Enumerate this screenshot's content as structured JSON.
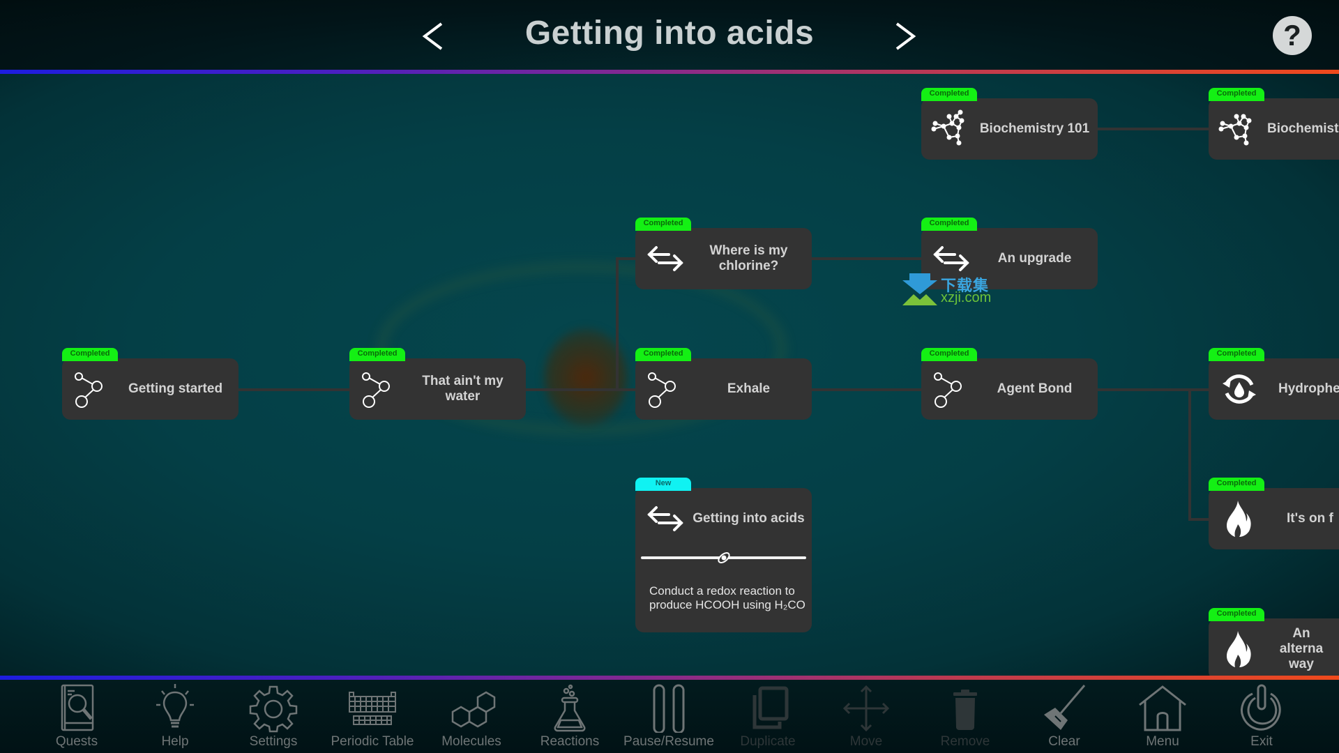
{
  "header": {
    "title": "Getting into acids",
    "prev_label": "<",
    "next_label": ">",
    "help_label": "?"
  },
  "nodes": [
    {
      "id": "biochemistry-101",
      "title": "Biochemistry 101",
      "status": "Completed",
      "icon": "molecule-structure-icon"
    },
    {
      "id": "biochemistry-2",
      "title": "Biochemist",
      "status": "Completed",
      "icon": "molecule-structure-icon"
    },
    {
      "id": "where-is-my-chlorine",
      "title": "Where is my chlorine?",
      "status": "Completed",
      "icon": "exchange-arrows-icon"
    },
    {
      "id": "an-upgrade",
      "title": "An upgrade",
      "status": "Completed",
      "icon": "exchange-arrows-icon"
    },
    {
      "id": "getting-started",
      "title": "Getting started",
      "status": "Completed",
      "icon": "bond-icon"
    },
    {
      "id": "that-aint-my-water",
      "title": "That ain't my water",
      "status": "Completed",
      "icon": "bond-icon"
    },
    {
      "id": "exhale",
      "title": "Exhale",
      "status": "Completed",
      "icon": "bond-icon"
    },
    {
      "id": "agent-bond",
      "title": "Agent Bond",
      "status": "Completed",
      "icon": "bond-icon"
    },
    {
      "id": "hydrophe",
      "title": "Hydrophe",
      "status": "Completed",
      "icon": "water-cycle-icon"
    },
    {
      "id": "its-on-f",
      "title": "It's on f",
      "status": "Completed",
      "icon": "flame-icon"
    },
    {
      "id": "an-alternative-way",
      "title": "An alterna way",
      "status": "Completed",
      "icon": "flame-icon"
    }
  ],
  "active_node": {
    "title": "Getting into acids",
    "status": "New",
    "icon": "exchange-arrows-icon",
    "description": "Conduct a redox reaction to produce HCOOH using H₂CO",
    "progress": 0.5
  },
  "watermark": {
    "cn": "下载集",
    "en": "xzji.com"
  },
  "toolbar": [
    {
      "label": "Quests",
      "icon": "quest-book-icon",
      "enabled": true
    },
    {
      "label": "Help",
      "icon": "lightbulb-icon",
      "enabled": true
    },
    {
      "label": "Settings",
      "icon": "gear-icon",
      "enabled": true
    },
    {
      "label": "Periodic Table",
      "icon": "periodic-table-icon",
      "enabled": true
    },
    {
      "label": "Molecules",
      "icon": "molecule-rings-icon",
      "enabled": true
    },
    {
      "label": "Reactions",
      "icon": "flask-icon",
      "enabled": true
    },
    {
      "label": "Pause/Resume",
      "icon": "pause-icon",
      "enabled": true
    },
    {
      "label": "Duplicate",
      "icon": "duplicate-icon",
      "enabled": false
    },
    {
      "label": "Move",
      "icon": "move-icon",
      "enabled": false
    },
    {
      "label": "Remove",
      "icon": "trash-icon",
      "enabled": false
    },
    {
      "label": "Clear",
      "icon": "broom-icon",
      "enabled": true
    },
    {
      "label": "Menu",
      "icon": "home-icon",
      "enabled": true
    },
    {
      "label": "Exit",
      "icon": "power-icon",
      "enabled": true
    }
  ],
  "colors": {
    "completed_badge": "#14f014",
    "new_badge": "#10f2f2",
    "node_bg": "#333333",
    "canvas_bg": "#043f46"
  }
}
